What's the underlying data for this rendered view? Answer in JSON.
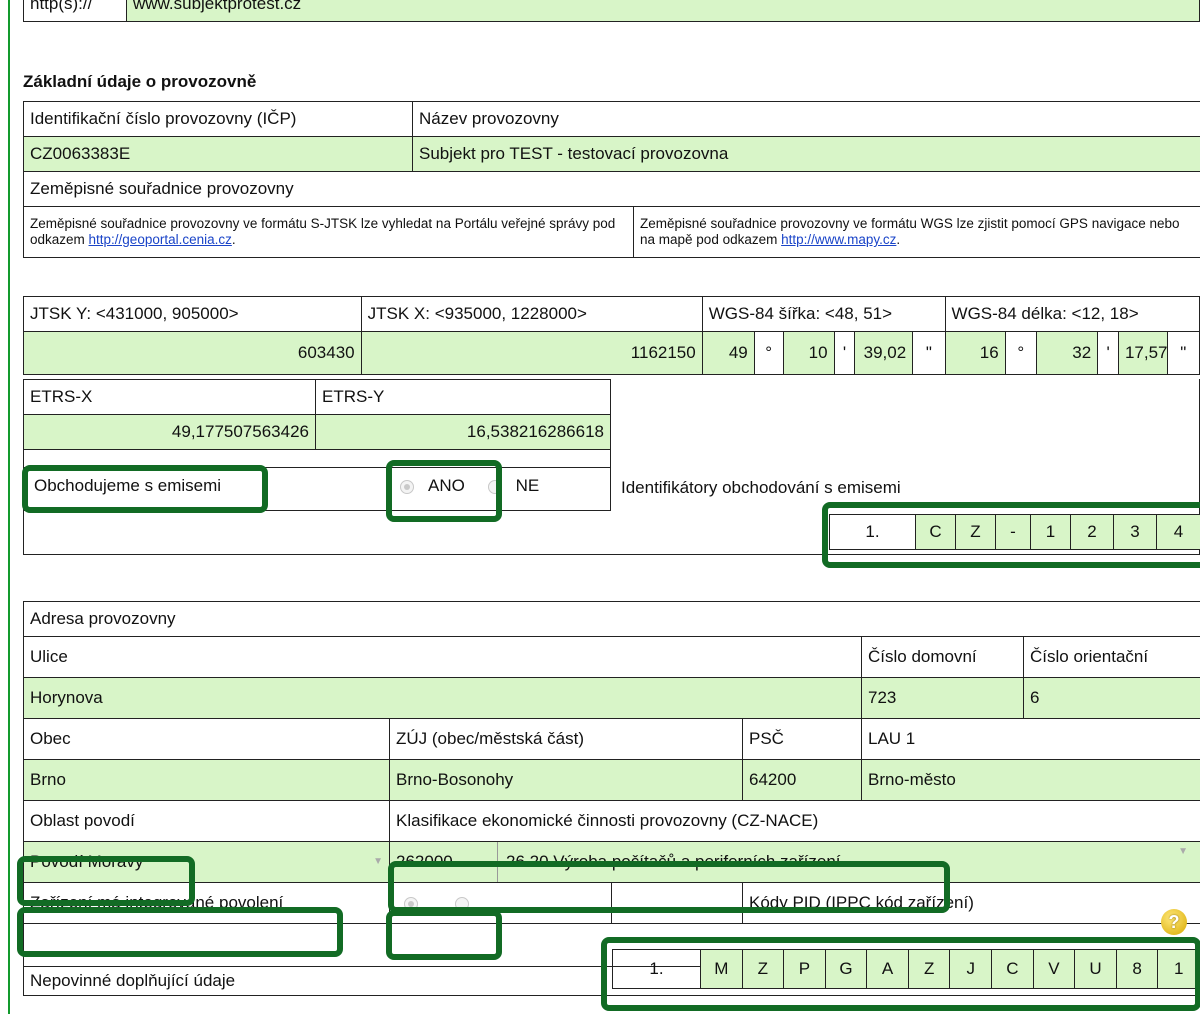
{
  "top_row": {
    "protocol_label": "http(s)://",
    "web_value": "www.subjektprotest.cz"
  },
  "section_title": "Základní údaje o provozovně",
  "basic": {
    "icp_label": "Identifikační číslo provozovny (IČP)",
    "name_label": "Název provozovny",
    "icp_value": "CZ0063383E",
    "name_value": "Subjekt pro TEST - testovací provozovna",
    "coords_header": "Zeměpisné souřadnice provozovny",
    "note_left_text": "Zeměpisné souřadnice provozovny ve formátu S-JTSK lze vyhledat na Portálu veřejné správy pod odkazem ",
    "note_left_link": "http://geoportal.cenia.cz",
    "note_right_text": "Zeměpisné souřadnice provozovny ve formátu WGS lze zjistit pomocí GPS navigace nebo na mapě pod odkazem ",
    "note_right_link": "http://www.mapy.cz",
    "jtsk_y_label": "JTSK Y: <431000, 905000>",
    "jtsk_x_label": "JTSK X: <935000, 1228000>",
    "wgs_lat_label": "WGS-84 šířka: <48, 51>",
    "wgs_lon_label": "WGS-84 délka: <12, 18>",
    "jtsk_y_value": "603430",
    "jtsk_x_value": "1162150",
    "lat": {
      "deg": "49",
      "deg_sym": "°",
      "min": "10",
      "min_sym": "'",
      "sec": "39,02",
      "sec_sym": "\""
    },
    "lon": {
      "deg": "16",
      "deg_sym": "°",
      "min": "32",
      "min_sym": "'",
      "sec": "17,57",
      "sec_sym": "\""
    },
    "etrs_x_label": "ETRS-X",
    "etrs_y_label": "ETRS-Y",
    "etrs_x_value": "49,177507563426",
    "etrs_y_value": "16,538216286618",
    "emissions_label": "Obchodujeme s emisemi",
    "yes": "ANO",
    "no": "NE",
    "emissions_ids_label": "Identifikátory obchodování s emisemi",
    "emissions_row_no": "1.",
    "emissions_chars": [
      "C",
      "Z",
      "-",
      "1",
      "2",
      "3",
      "4"
    ]
  },
  "address": {
    "header": "Adresa provozovny",
    "street_label": "Ulice",
    "house_no_label": "Číslo domovní",
    "orient_no_label": "Číslo orientační",
    "street_value": "Horynova",
    "house_no_value": "723",
    "orient_no_value": "6",
    "city_label": "Obec",
    "zuj_label": "ZÚJ (obec/městská část)",
    "psc_label": "PSČ",
    "lau_label": "LAU 1",
    "city_value": "Brno",
    "zuj_value": "Brno-Bosonohy",
    "psc_value": "64200",
    "lau_value": "Brno-město",
    "basin_label": "Oblast povodí",
    "nace_label": "Klasifikace ekonomické činnosti provozovny (CZ-NACE)",
    "basin_value": "Povodí Moravy",
    "nace_code": "262000",
    "nace_value": "26.20 Výroba počítačů a periferních zařízení",
    "ippc_label": "Zařízení má integrované povolení",
    "pid_label": "Kódy PID (IPPC kód zařízení)",
    "help_symbol": "?",
    "pid_row_no": "1.",
    "pid_chars": [
      "M",
      "Z",
      "P",
      "G",
      "A",
      "Z",
      "J",
      "C",
      "V",
      "U",
      "8",
      "1"
    ],
    "optional_label": "Nepovinné doplňující údaje"
  }
}
